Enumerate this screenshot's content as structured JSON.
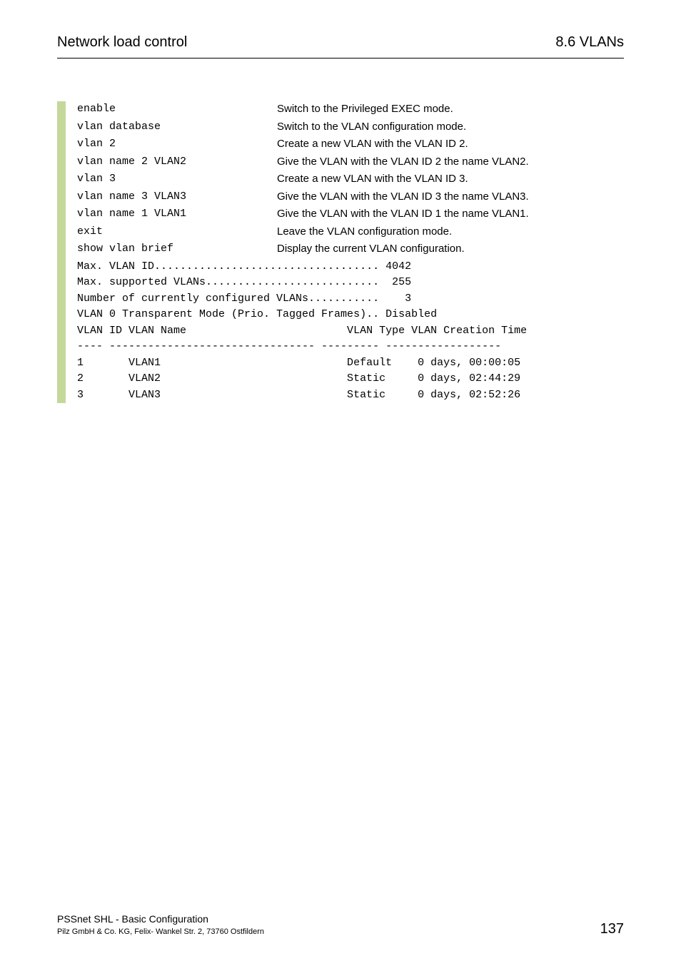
{
  "header": {
    "left": "Network load control",
    "right": "8.6 VLANs"
  },
  "commands": [
    {
      "cmd": "enable",
      "desc": "Switch to the Privileged EXEC mode."
    },
    {
      "cmd": "vlan database",
      "desc": "Switch to the VLAN configuration mode."
    },
    {
      "cmd": "vlan 2",
      "desc": "Create a new VLAN with the VLAN ID 2."
    },
    {
      "cmd": "vlan name 2 VLAN2",
      "desc": "Give the VLAN with the VLAN ID 2 the name VLAN2."
    },
    {
      "cmd": "vlan 3",
      "desc": "Create a new VLAN with the VLAN ID 3."
    },
    {
      "cmd": "vlan name 3 VLAN3",
      "desc": "Give the VLAN with the VLAN ID 3 the name VLAN3."
    },
    {
      "cmd": "vlan name 1 VLAN1",
      "desc": "Give the VLAN with the VLAN ID 1 the name VLAN1."
    },
    {
      "cmd": "exit",
      "desc": "Leave the VLAN configuration mode."
    },
    {
      "cmd": "show vlan brief",
      "desc": "Display the current VLAN configuration."
    }
  ],
  "output": "Max. VLAN ID................................... 4042\nMax. supported VLANs...........................  255\nNumber of currently configured VLANs...........    3\nVLAN 0 Transparent Mode (Prio. Tagged Frames).. Disabled\nVLAN ID VLAN Name                         VLAN Type VLAN Creation Time\n---- -------------------------------- --------- ------------------\n1       VLAN1                             Default    0 days, 00:00:05\n2       VLAN2                             Static     0 days, 02:44:29\n3       VLAN3                             Static     0 days, 02:52:26",
  "footer": {
    "title": "PSSnet SHL - Basic Configuration",
    "sub": "Pilz GmbH & Co. KG, Felix- Wankel Str. 2, 73760 Ostfildern",
    "page": "137"
  },
  "chart_data": {
    "type": "table",
    "title": "VLAN configuration output",
    "summary": {
      "Max. VLAN ID": 4042,
      "Max. supported VLANs": 255,
      "Number of currently configured VLANs": 3,
      "VLAN 0 Transparent Mode (Prio. Tagged Frames)": "Disabled"
    },
    "columns": [
      "VLAN ID",
      "VLAN Name",
      "VLAN Type",
      "VLAN Creation Time"
    ],
    "rows": [
      {
        "VLAN ID": 1,
        "VLAN Name": "VLAN1",
        "VLAN Type": "Default",
        "VLAN Creation Time": "0 days, 00:00:05"
      },
      {
        "VLAN ID": 2,
        "VLAN Name": "VLAN2",
        "VLAN Type": "Static",
        "VLAN Creation Time": "0 days, 02:44:29"
      },
      {
        "VLAN ID": 3,
        "VLAN Name": "VLAN3",
        "VLAN Type": "Static",
        "VLAN Creation Time": "0 days, 02:52:26"
      }
    ]
  }
}
